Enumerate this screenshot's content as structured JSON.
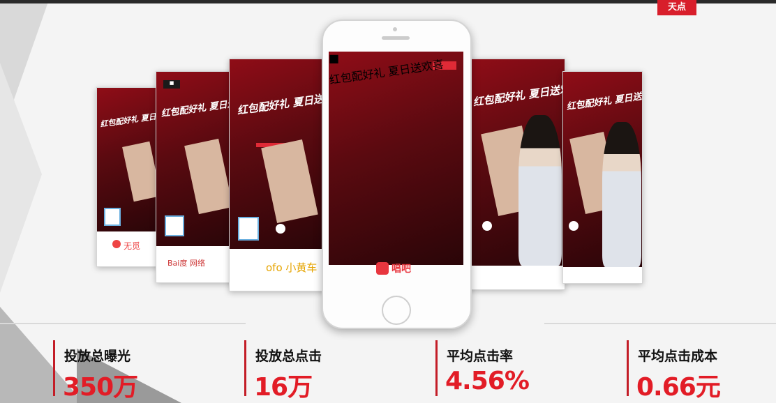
{
  "colors": {
    "accent": "#e21c26",
    "poster_red": "#8f0d17",
    "background": "#f4f4f4"
  },
  "poster_headline": "红包配好礼 夏日送欢喜",
  "cards": [
    {
      "footer": "无觅"
    },
    {
      "footer": "Bai度 网络"
    },
    {
      "footer": "ofo 小黄车"
    },
    {
      "footer": ""
    },
    {
      "footer": ""
    }
  ],
  "phone": {
    "app_name": "唱吧"
  },
  "stats": [
    {
      "label": "投放总曝光",
      "value": "350万"
    },
    {
      "label": "投放总点击",
      "value": "16万"
    },
    {
      "label": "平均点击率",
      "value": "4.56%"
    },
    {
      "label": "平均点击成本",
      "value": "0.66元"
    }
  ]
}
